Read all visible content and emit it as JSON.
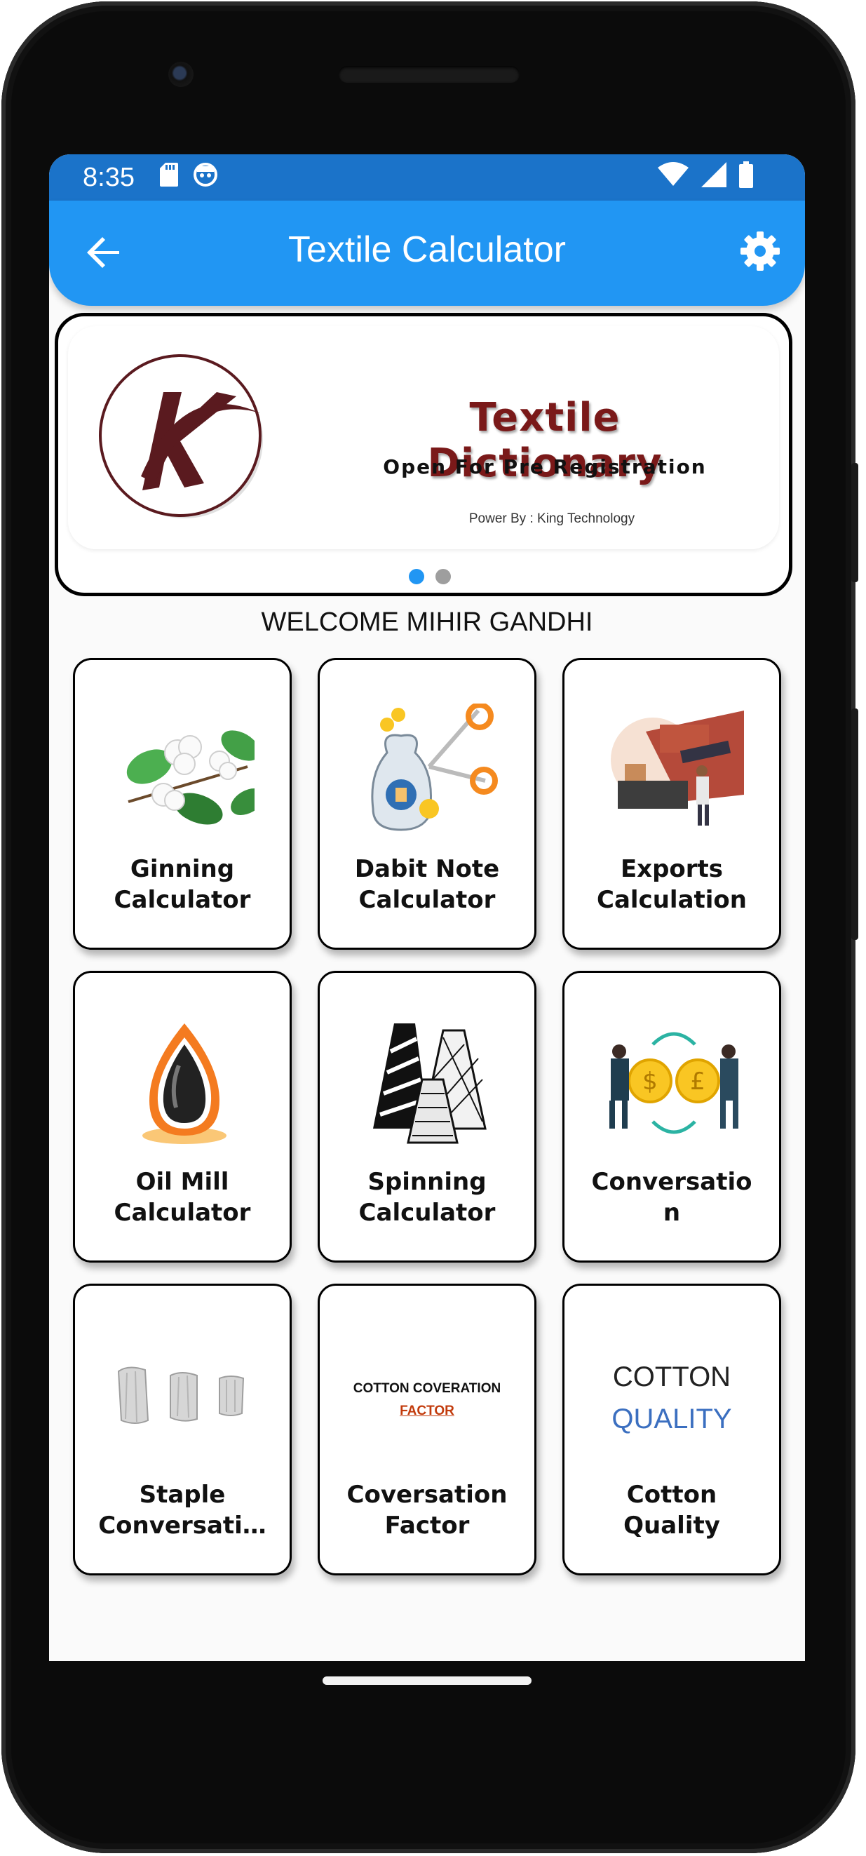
{
  "status_bar": {
    "time": "8:35",
    "left_icons": [
      "sd-card-icon",
      "android-notification-icon"
    ],
    "right_icons": [
      "wifi-icon",
      "signal-icon",
      "battery-icon"
    ]
  },
  "app_bar": {
    "title": "Textile Calculator",
    "back_icon": "arrow-back-icon",
    "settings_icon": "gear-icon",
    "color": "#2196f3"
  },
  "banner": {
    "logo_letter": "K",
    "title": "Textile Dictionary",
    "subtitle": "Open For Pre Registration",
    "power_by": "Power By : King Technology",
    "page_count": 2,
    "active_page": 1
  },
  "welcome_text": "WELCOME MIHIR GANDHI",
  "cards": [
    {
      "label_line1": "Ginning",
      "label_line2": "Calculator",
      "icon": "cotton-plant-icon"
    },
    {
      "label_line1": "Dabit Note",
      "label_line2": "Calculator",
      "icon": "gst-money-bag-scissors-icon"
    },
    {
      "label_line1": "Exports",
      "label_line2": "Calculation",
      "icon": "export-import-ship-icon"
    },
    {
      "label_line1": "Oil Mill",
      "label_line2": "Calculator",
      "icon": "oil-drop-flame-icon"
    },
    {
      "label_line1": "Spinning",
      "label_line2": "Calculator",
      "icon": "yarn-cones-icon"
    },
    {
      "label_line1": "Conversatio",
      "label_line2": "n",
      "icon": "currency-exchange-icon"
    },
    {
      "label_line1": "Staple",
      "label_line2": "Conversati…",
      "icon": "cotton-fiber-samples-icon"
    },
    {
      "label_line1": "Coversation",
      "label_line2": "Factor",
      "image_text1": "COTTON COVERATION",
      "image_text2": "FACTOR"
    },
    {
      "label_line1": "Cotton",
      "label_line2": "Quality",
      "image_text1": "COTTON",
      "image_text2": "QUALITY"
    }
  ]
}
